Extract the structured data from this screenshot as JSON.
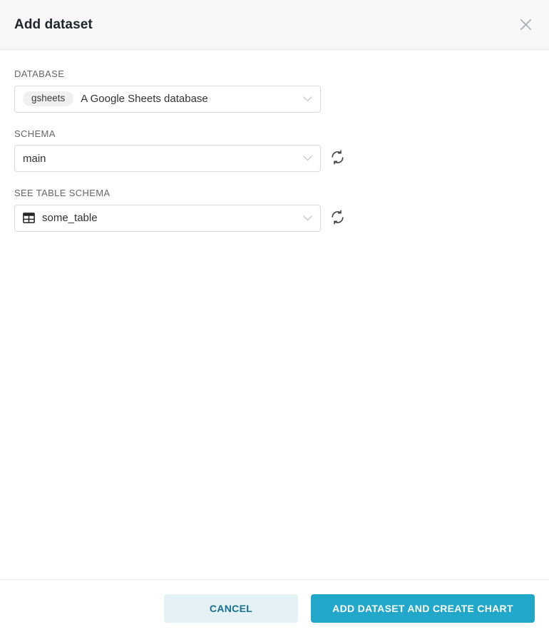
{
  "header": {
    "title": "Add dataset",
    "close_icon": "close-icon"
  },
  "body": {
    "fields": [
      {
        "label": "DATABASE",
        "pill": "gsheets",
        "value": "A Google Sheets database",
        "has_refresh": false,
        "has_table_icon": false,
        "chevron_icon": "chevron-down-icon"
      },
      {
        "label": "SCHEMA",
        "pill": null,
        "value": "main",
        "has_refresh": true,
        "has_table_icon": false,
        "chevron_icon": "chevron-down-icon",
        "refresh_icon": "refresh-icon"
      },
      {
        "label": "SEE TABLE SCHEMA",
        "pill": null,
        "value": "some_table",
        "has_refresh": true,
        "has_table_icon": true,
        "table_icon": "table-icon",
        "chevron_icon": "chevron-down-icon",
        "refresh_icon": "refresh-icon"
      }
    ]
  },
  "footer": {
    "cancel_label": "CANCEL",
    "submit_label": "ADD DATASET AND CREATE CHART"
  },
  "colors": {
    "primary": "#20a7c9",
    "cancel_bg": "#e4f2f6",
    "cancel_text": "#1a6e8e",
    "header_bg": "#f7f7f7",
    "border": "#d9d9d9",
    "label_text": "#666666",
    "title_text": "#20242b",
    "pill_bg": "#f0f0f0",
    "chevron": "#c3c6cd"
  }
}
